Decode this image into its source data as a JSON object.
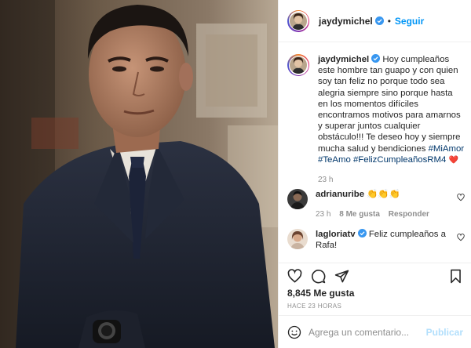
{
  "post": {
    "author": "jaydymichel",
    "follow_label": "Seguir",
    "separator": "•"
  },
  "caption": {
    "username": "jaydymichel",
    "text": "Hoy cumpleaños este hombre tan guapo y con quien soy tan feliz no porque todo sea alegria siempre sino porque hasta en los momentos difíciles encontramos motivos para amarnos y superar juntos cualquier obstáculo!!! Te deseo hoy y siempre mucha salud y bendiciones",
    "hashtags": [
      "#MiAmor",
      "#TeAmo",
      "#FelizCumpleañosRM4"
    ],
    "emoji": "❤️",
    "time": "23 h"
  },
  "comments": [
    {
      "username": "adrianuribe",
      "text": "👏👏👏",
      "time": "23 h",
      "likes": "8 Me gusta",
      "reply_label": "Responder"
    },
    {
      "username": "lagloriatv",
      "text": "Feliz cumpleaños a Rafa!"
    }
  ],
  "stats": {
    "likes": "8,845 Me gusta",
    "posted_ago": "HACE 23 HORAS"
  },
  "composer": {
    "placeholder": "Agrega un comentario...",
    "publish_label": "Publicar"
  },
  "colors": {
    "accent": "#0095f6",
    "hashtag": "#00376b",
    "muted": "#8e8e8e",
    "publish_disabled": "#b2dffc",
    "heart": "#ed4956"
  },
  "icons": {
    "verified": "verified-badge-icon",
    "like": "heart-outline-icon",
    "comment": "comment-bubble-icon",
    "share": "paper-plane-icon",
    "save": "bookmark-icon",
    "emoji": "smiley-icon"
  }
}
